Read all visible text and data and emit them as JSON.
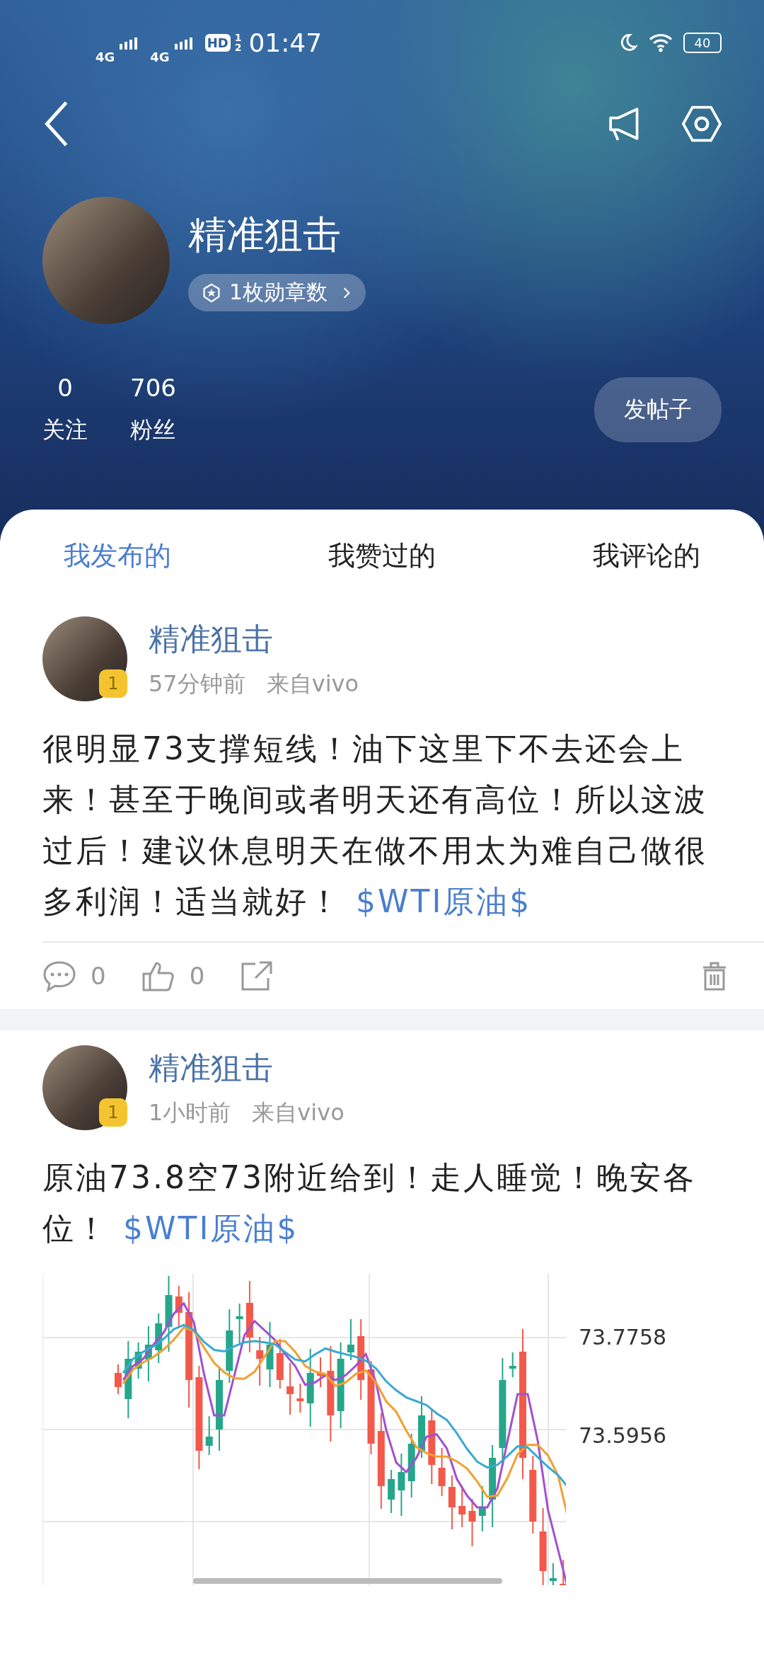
{
  "status_bar": {
    "network_labels": [
      "4G",
      "4G"
    ],
    "hd_label": "HD",
    "hd_slots": [
      "1",
      "2"
    ],
    "time": "01:47",
    "battery": "40"
  },
  "profile": {
    "name": "精准狙击",
    "badge": "1枚勋章数",
    "stats": [
      {
        "value": "0",
        "label": "关注"
      },
      {
        "value": "706",
        "label": "粉丝"
      }
    ],
    "post_button": "发帖子"
  },
  "tabs": [
    {
      "label": "我发布的",
      "selected": true
    },
    {
      "label": "我赞过的",
      "selected": false
    },
    {
      "label": "我评论的",
      "selected": false
    }
  ],
  "posts": [
    {
      "author": "精准狙击",
      "level": "1",
      "time": "57分钟前",
      "source": "来自vivo",
      "text": "很明显73支撑短线！油下这里下不去还会上来！甚至于晚间或者明天还有高位！所以这波过后！建议休息明天在做不用太为难自己做很多利润！适当就好！",
      "topic": "$WTI原油$",
      "comments": "0",
      "likes": "0"
    },
    {
      "author": "精准狙击",
      "level": "1",
      "time": "1小时前",
      "source": "来自vivo",
      "text": "原油73.8空73附近给到！走人睡觉！晚安各位！",
      "topic": "$WTI原油$",
      "chart_image": {
        "price_labels": [
          "73.7758",
          "73.5956"
        ]
      }
    }
  ]
}
